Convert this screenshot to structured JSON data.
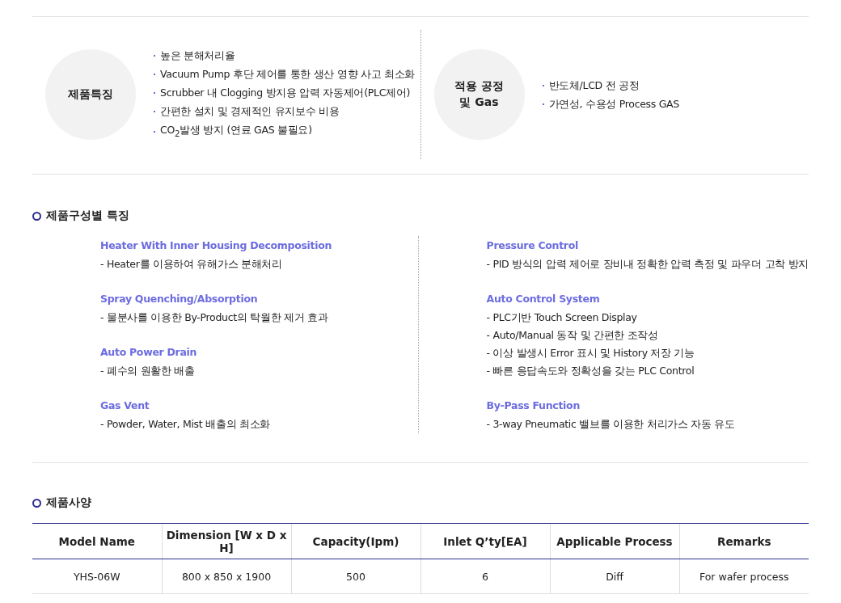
{
  "summary": [
    {
      "label": "제품특징",
      "bullets": [
        "높은 분해처리율",
        "Vacuum Pump 후단 제어를 통한 생산 영향 사고 최소화",
        "Scrubber 내 Clogging 방지용 압력 자동제어(PLC제어)",
        "간편한 설치 및 경제적인 유지보수 비용",
        "CO$_{2}$발생 방지 (연료 GAS 불필요)"
      ]
    },
    {
      "label": "적용 공정\n및 Gas",
      "bullets": [
        "반도체/LCD 전 공정",
        "가연성, 수용성 Process GAS"
      ]
    }
  ],
  "features": {
    "title": "제품구성별 특징",
    "columns": [
      [
        {
          "title": "Heater With Inner Housing Decomposition",
          "lines": [
            "- Heater를 이용하여 유해가스 분해처리"
          ]
        },
        {
          "title": "Spray Quenching/Absorption",
          "lines": [
            "- 물분사를 이용한 By-Product의 탁월한 제거 효과"
          ]
        },
        {
          "title": "Auto Power Drain",
          "lines": [
            "- 폐수의 원활한 배출"
          ]
        },
        {
          "title": "Gas Vent",
          "lines": [
            "- Powder, Water, Mist 배출의 최소화"
          ]
        }
      ],
      [
        {
          "title": "Pressure Control",
          "lines": [
            "- PID 방식의 압력 제어로 장비내 정확한 압력 측정 및 파우더 고착 방지"
          ]
        },
        {
          "title": "Auto Control System",
          "lines": [
            "- PLC기반 Touch Screen Display",
            "- Auto/Manual 동작 및 간편한 조작성",
            "- 이상 발생시 Error 표시 및 History 저장 기능",
            "- 빠른 응답속도와 정확성을 갖는 PLC Control"
          ]
        },
        {
          "title": "By-Pass Function",
          "lines": [
            "- 3-way Pneumatic 밸브를 이용한 처리가스 자동 유도"
          ]
        }
      ]
    ]
  },
  "specs": {
    "title": "제품사양",
    "columns": [
      "Model Name",
      "Dimension [W x D x H]",
      "Capacity(Ipm)",
      "Inlet Q’ty[EA]",
      "Applicable Process",
      "Remarks"
    ],
    "rows": [
      [
        "YHS-06W",
        "800 x 850 x 1900",
        "500",
        "6",
        "Diff",
        "For wafer process"
      ]
    ]
  }
}
